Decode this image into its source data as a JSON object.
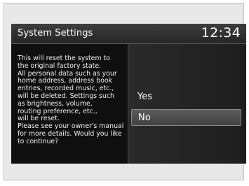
{
  "screen": {
    "title": "System Settings",
    "clock": "12:34",
    "message": "This will reset the system to\nthe original factory state.\nAll personal data such as your\nhome address, address book\nentries, recorded music, etc.,\nwill be deleted. Settings such\nas brightness, volume,\nrouting preference, etc.,\nwill be reset.\nPlease see your owner's manual\nfor more details. Would you like\nto continue?",
    "options": [
      {
        "label": "Yes",
        "selected": false
      },
      {
        "label": "No",
        "selected": true
      }
    ]
  }
}
